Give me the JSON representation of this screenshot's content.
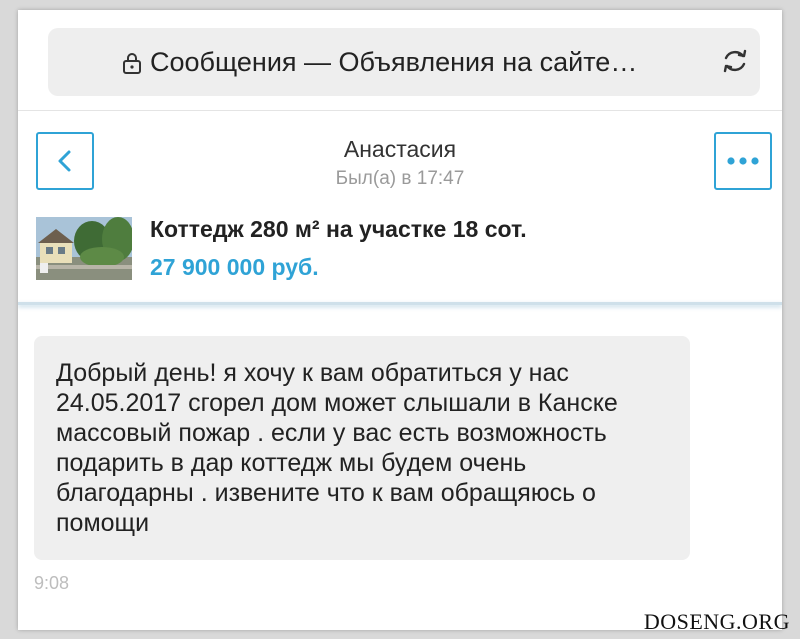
{
  "browser": {
    "address_title": "Сообщения — Объявления на сайте…",
    "lock_icon": "lock-icon",
    "reload_icon": "reload-icon"
  },
  "chat_header": {
    "contact_name": "Анастасия",
    "last_seen": "Был(а) в 17:47",
    "back_icon": "chevron-left-icon",
    "more_icon": "more-dots-icon",
    "accent_color": "#2fa3d6"
  },
  "listing": {
    "title": "Коттедж 280 м² на участке 18 сот.",
    "price": "27 900 000 руб."
  },
  "messages": [
    {
      "text": "Добрый день! я хочу к вам обратиться у нас 24.05.2017 сгорел дом может слышали в Канске массовый пожар . если у вас есть возможность подарить в дар коттедж мы будем очень благодарны . извените что к вам обращяюсь о помощи",
      "time": "9:08"
    }
  ],
  "watermark": "DOSENG.ORG"
}
